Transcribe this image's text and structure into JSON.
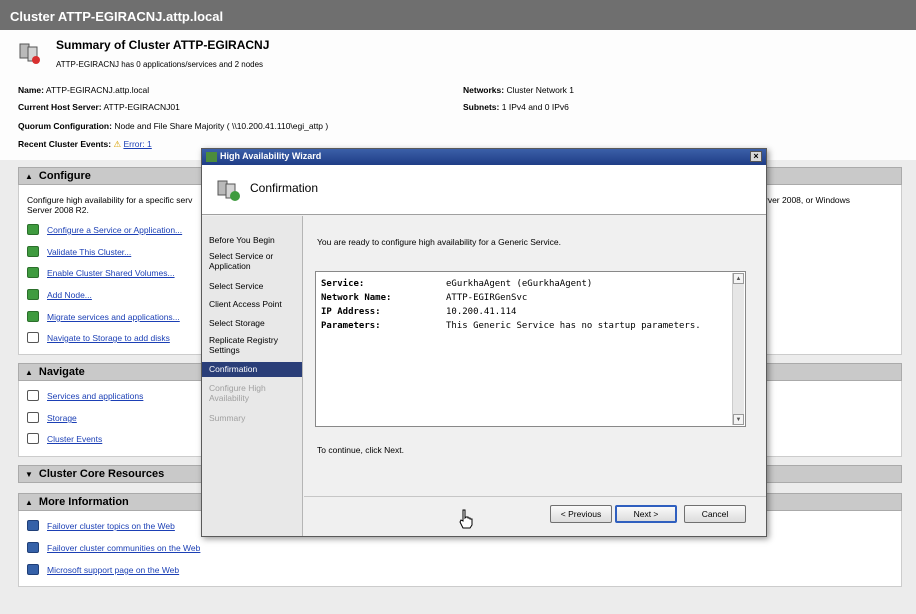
{
  "window": {
    "title": "Cluster ATTP-EGIRACNJ.attp.local"
  },
  "summary": {
    "title": "Summary of Cluster ATTP-EGIRACNJ",
    "subtitle": "ATTP-EGIRACNJ has 0 applications/services and 2 nodes",
    "name_label": "Name:",
    "name_value": "ATTP-EGIRACNJ.attp.local",
    "host_label": "Current Host Server:",
    "host_value": "ATTP-EGIRACNJ01",
    "quorum_label": "Quorum Configuration:",
    "quorum_value": "Node and File Share Majority ( \\\\10.200.41.110\\egi_attp )",
    "events_label": "Recent Cluster Events:",
    "events_value": "Error: 1",
    "networks_label": "Networks:",
    "networks_value": "Cluster Network 1",
    "subnets_label": "Subnets:",
    "subnets_value": "1 IPv4 and 0 IPv6"
  },
  "configure": {
    "header": "Configure",
    "description_left": "Configure high availability for a specific serv",
    "description_left2": "Server 2008 R2.",
    "description_right": "rver 2008, or Windows",
    "actions": [
      "Configure a Service or Application...",
      "Validate This Cluster...",
      "Enable Cluster Shared Volumes...",
      "Add Node...",
      "Migrate services and applications...",
      "Navigate to Storage to add disks"
    ]
  },
  "navigate": {
    "header": "Navigate",
    "links": [
      "Services and applications",
      "Storage",
      "Cluster Events"
    ]
  },
  "core": {
    "header": "Cluster Core Resources"
  },
  "more_info": {
    "header": "More Information",
    "links": [
      "Failover cluster topics on the Web",
      "Failover cluster communities on the Web",
      "Microsoft support page on the Web"
    ]
  },
  "wizard": {
    "title": "High Availability Wizard",
    "close": "×",
    "header": "Confirmation",
    "steps": [
      "Before You Begin",
      "Select Service or Application",
      "Select Service",
      "Client Access Point",
      "Select Storage",
      "Replicate Registry Settings",
      "Confirmation",
      "Configure High Availability",
      "Summary"
    ],
    "active_step": "Confirmation",
    "ready_text": "You are ready to configure high availability for a Generic Service.",
    "info": [
      {
        "label": "Service:",
        "value": "eGurkhaAgent (eGurkhaAgent)"
      },
      {
        "label": "Network Name:",
        "value": "ATTP-EGIRGenSvc"
      },
      {
        "label": "IP Address:",
        "value": "10.200.41.114"
      },
      {
        "label": "Parameters:",
        "value": "This Generic Service has no startup parameters."
      }
    ],
    "continue_text": "To continue, click Next.",
    "buttons": {
      "previous": "< Previous",
      "next": "Next >",
      "cancel": "Cancel"
    }
  },
  "colors": {
    "accent": "#2a3e78",
    "title_bar": "#6f6f6f",
    "link": "#1b3fb5"
  }
}
